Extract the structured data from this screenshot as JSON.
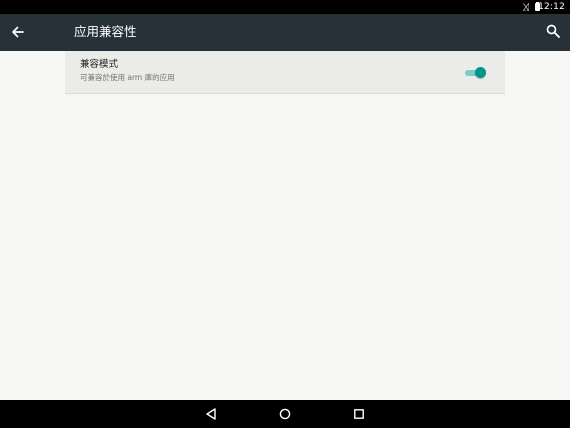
{
  "status_bar": {
    "time": "12:12",
    "icons": [
      "signal-icon",
      "battery-icon"
    ]
  },
  "app_bar": {
    "title": "应用兼容性",
    "back_icon": "arrow-back-icon",
    "search_icon": "search-icon"
  },
  "setting": {
    "title": "兼容模式",
    "summary": "可兼容於使用 arm 庫的应用",
    "enabled": true,
    "accent_color": "#009688"
  },
  "nav_bar": {
    "buttons": [
      "nav-back-icon",
      "nav-home-icon",
      "nav-recents-icon"
    ]
  }
}
